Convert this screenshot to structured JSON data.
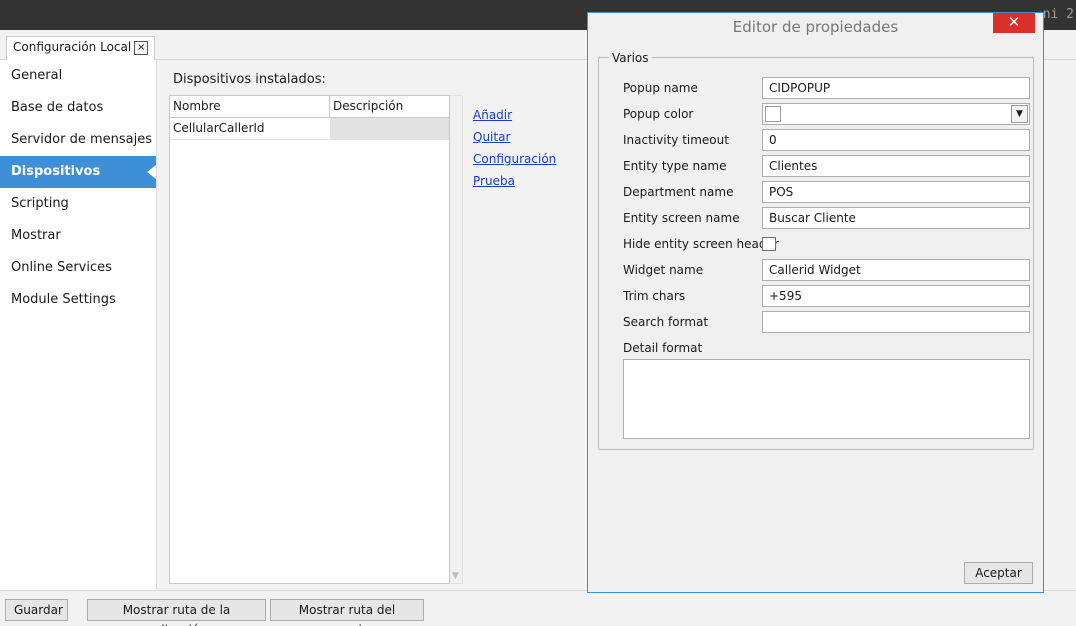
{
  "topbar": {
    "text": "ni 2"
  },
  "tab": {
    "label": "Configuración Local",
    "close": "×"
  },
  "sidebar": {
    "items": [
      {
        "label": "General"
      },
      {
        "label": "Base de datos"
      },
      {
        "label": "Servidor de mensajes"
      },
      {
        "label": "Dispositivos",
        "active": true
      },
      {
        "label": "Scripting"
      },
      {
        "label": "Mostrar"
      },
      {
        "label": "Online Services"
      },
      {
        "label": "Module Settings"
      }
    ]
  },
  "main": {
    "installed_label": "Dispositivos instalados:",
    "grid": {
      "columns": [
        "Nombre",
        "Descripción"
      ],
      "rows": [
        [
          "CellularCallerId",
          ""
        ]
      ]
    },
    "links": [
      "Añadir",
      "Quitar",
      "Configuración",
      "Prueba"
    ]
  },
  "bottom": {
    "save": "Guardar",
    "app_path": "Mostrar ruta de la aplicación",
    "user_path": "Mostrar ruta del usuario"
  },
  "dialog": {
    "title": "Editor de propiedades",
    "close": "✕",
    "group": "Varios",
    "popup_name": {
      "label": "Popup name",
      "value": "CIDPOPUP"
    },
    "popup_color": {
      "label": "Popup color",
      "value": "#ffffff"
    },
    "inactivity_timeout": {
      "label": "Inactivity timeout",
      "value": "0"
    },
    "entity_type_name": {
      "label": "Entity type name",
      "value": "Clientes"
    },
    "department_name": {
      "label": "Department name",
      "value": "POS"
    },
    "entity_screen_name": {
      "label": "Entity screen name",
      "value": "Buscar Cliente"
    },
    "hide_entity_screen_header": {
      "label": "Hide entity screen header",
      "checked": false
    },
    "widget_name": {
      "label": "Widget name",
      "value": "Callerid Widget"
    },
    "trim_chars": {
      "label": "Trim chars",
      "value": "+595"
    },
    "search_format": {
      "label": "Search format",
      "value": ""
    },
    "detail_format": {
      "label": "Detail format",
      "value": ""
    },
    "ok": "Aceptar"
  },
  "colors": {
    "accent": "#3d8fd8",
    "close_red": "#d9302c",
    "link": "#1a3cc8"
  }
}
